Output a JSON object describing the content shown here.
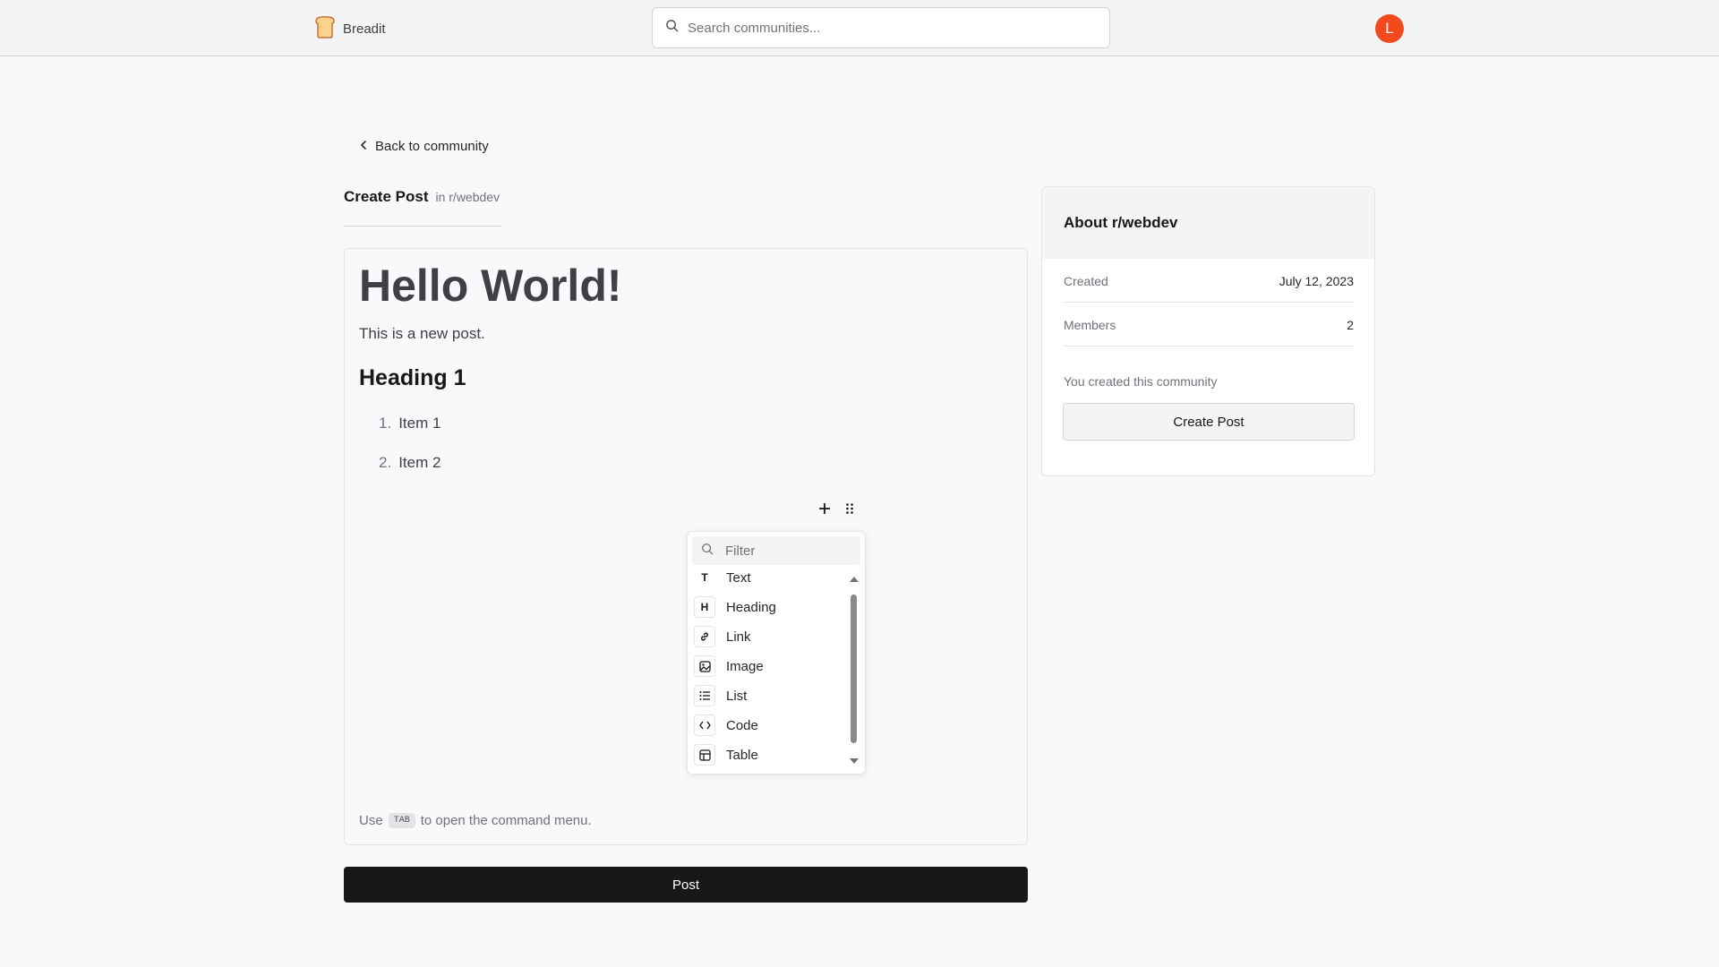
{
  "header": {
    "brand": "Breadit",
    "search_placeholder": "Search communities...",
    "avatar_initial": "L",
    "avatar_color": "#f24a1d"
  },
  "nav": {
    "back_label": "Back to community"
  },
  "page": {
    "title": "Create Post",
    "subtitle": "in r/webdev"
  },
  "editor": {
    "heading1": "Hello World!",
    "paragraph": "This is a new post.",
    "heading2": "Heading 1",
    "list": [
      {
        "num": "1.",
        "text": "Item 1"
      },
      {
        "num": "2.",
        "text": "Item 2"
      }
    ],
    "hint_prefix": "Use",
    "hint_key": "TAB",
    "hint_suffix": "to open the command menu."
  },
  "command_menu": {
    "filter_placeholder": "Filter",
    "items": [
      {
        "icon": "text-icon",
        "glyph": "T",
        "label": "Text"
      },
      {
        "icon": "heading-icon",
        "glyph": "H",
        "label": "Heading"
      },
      {
        "icon": "link-icon",
        "glyph": "",
        "label": "Link"
      },
      {
        "icon": "image-icon",
        "glyph": "",
        "label": "Image"
      },
      {
        "icon": "list-icon",
        "glyph": "",
        "label": "List"
      },
      {
        "icon": "code-icon",
        "glyph": "",
        "label": "Code"
      },
      {
        "icon": "table-icon",
        "glyph": "",
        "label": "Table"
      }
    ]
  },
  "actions": {
    "post_label": "Post"
  },
  "sidebar": {
    "title": "About r/webdev",
    "rows": [
      {
        "key": "Created",
        "value": "July 12, 2023"
      },
      {
        "key": "Members",
        "value": "2"
      }
    ],
    "note": "You created this community",
    "button_label": "Create Post"
  }
}
